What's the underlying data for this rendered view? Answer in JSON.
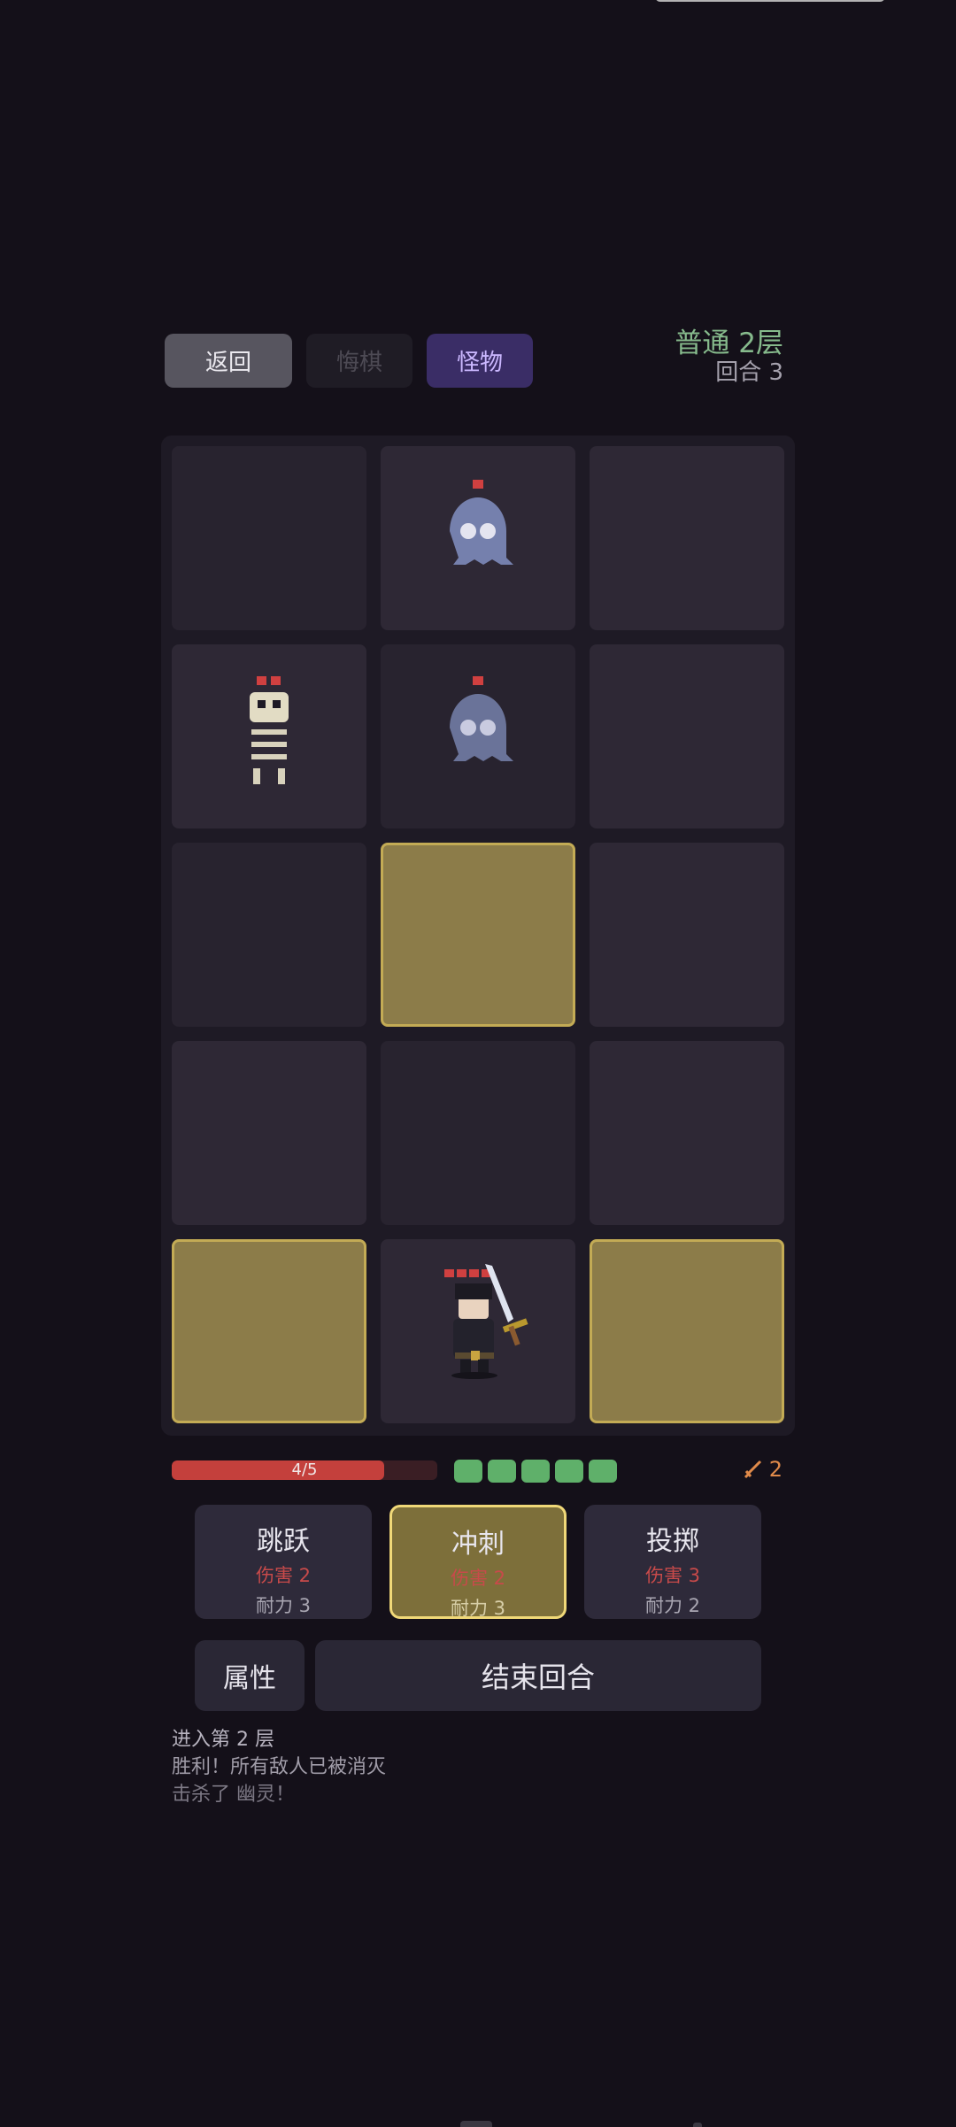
{
  "header": {
    "back_label": "返回",
    "undo_label": "悔棋",
    "monster_label": "怪物",
    "floor_title": "普通 2层",
    "round_label": "回合 3"
  },
  "player": {
    "hp_text": "4/5",
    "hp_fraction": 0.8,
    "stamina_pips": 5,
    "attack": "2"
  },
  "skills": [
    {
      "name": "跳跃",
      "damage": "伤害 2",
      "stamina": "耐力 3",
      "selected": false
    },
    {
      "name": "冲刺",
      "damage": "伤害 2",
      "stamina": "耐力 3",
      "selected": true
    },
    {
      "name": "投掷",
      "damage": "伤害 3",
      "stamina": "耐力 2",
      "selected": false
    }
  ],
  "actions": {
    "attributes_label": "属性",
    "end_turn_label": "结束回合"
  },
  "log": [
    "进入第 2 层",
    "胜利！所有敌人已被消灭",
    "击杀了 幽灵！"
  ],
  "board": {
    "rows": 5,
    "cols": 3,
    "units": [
      {
        "type": "ghost",
        "row": 0,
        "col": 1,
        "hp": 1
      },
      {
        "type": "skeleton",
        "row": 1,
        "col": 0,
        "hp": 2
      },
      {
        "type": "ghost",
        "row": 1,
        "col": 1,
        "hp": 1
      },
      {
        "type": "hero",
        "row": 4,
        "col": 1,
        "hp": 4
      }
    ],
    "highlighted_cells": [
      [
        2,
        1
      ],
      [
        4,
        0
      ],
      [
        4,
        2
      ]
    ]
  },
  "colors": {
    "background": "#141019",
    "highlight": "#8c7c49",
    "hp_red": "#c4403c",
    "stamina_green": "#5fb06a",
    "floor_green": "#86ba8c"
  }
}
